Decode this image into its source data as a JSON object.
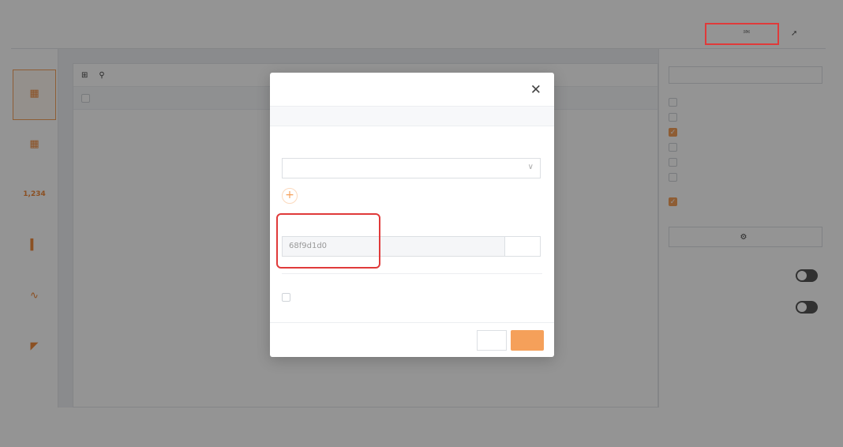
{
  "header": {
    "title": "",
    "permission_label": "",
    "share_label": ""
  },
  "rail": {
    "header": "",
    "items": [
      {
        "label": "",
        "icon": "table-icon",
        "active": true
      },
      {
        "label": "",
        "icon": "summary-table-icon"
      },
      {
        "label": "",
        "number": "1,234",
        "icon": "metric-card-icon"
      },
      {
        "label": "",
        "icon": "bar-chart-icon"
      },
      {
        "label": "",
        "icon": "line-chart-icon"
      },
      {
        "label": "",
        "icon": "pie-chart-icon"
      }
    ]
  },
  "main": {
    "toolbar": {
      "view_label": "",
      "search_label": ""
    },
    "columns": [
      "",
      ""
    ],
    "empty_text": ""
  },
  "side": {
    "title_label": "",
    "title_value": "",
    "permissions_label": "",
    "permissions": [
      {
        "label": "",
        "checked": false
      },
      {
        "label": "",
        "checked": false
      },
      {
        "label": "",
        "checked": true
      },
      {
        "label": "",
        "checked": false
      },
      {
        "label": "",
        "checked": false
      },
      {
        "label": "",
        "checked": false
      }
    ],
    "view_label": "",
    "view_option": "",
    "data_range_label": "",
    "filter_button": "",
    "sort_label": "",
    "query_label": ""
  },
  "annotation": {
    "text": ""
  },
  "modal": {
    "title": "",
    "tip": "",
    "scope_label": "",
    "scope_value": "",
    "id_label": "",
    "id_value": "68f9d1d0",
    "copy_label": "",
    "password_label": "",
    "cancel_label": "",
    "ok_label": ""
  },
  "colors": {
    "accent": "#f5a05a",
    "annotation": "#e03a3a",
    "overlay": "rgba(0,0,0,0.42)"
  }
}
